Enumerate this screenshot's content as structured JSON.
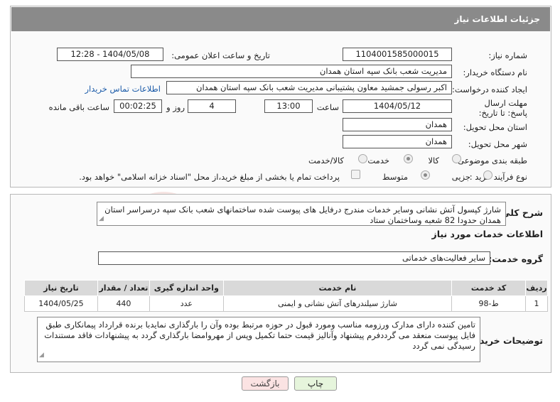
{
  "header": {
    "title": "جزئیات اطلاعات نیاز"
  },
  "fields": {
    "need_number_label": "شماره نیاز:",
    "need_number": "1104001585000015",
    "announce_label": "تاریخ و ساعت اعلان عمومی:",
    "announce_value": "1404/05/08 - 12:28",
    "buyer_label": "نام دستگاه خریدار:",
    "buyer_value": "مدیریت شعب بانک سپه استان همدان",
    "creator_label": "ایجاد کننده درخواست:",
    "creator_value": "اکبر رسولی جمشید معاون پشتیبانی مدیریت شعب بانک سپه استان همدان",
    "contact_link": "اطلاعات تماس خریدار",
    "deadline_label": "مهلت ارسال پاسخ: تا تاریخ:",
    "deadline_date": "1404/05/12",
    "time_label": "ساعت",
    "deadline_time": "13:00",
    "days_value": "4",
    "days_label": "روز و",
    "remaining_value": "00:02:25",
    "remaining_label": "ساعت باقی مانده",
    "province_label": "استان محل تحویل:",
    "province_value": "همدان",
    "city_label": "شهر محل تحویل:",
    "city_value": "همدان",
    "category_label": "طبقه بندی موضوعی:",
    "category_options": [
      "کالا",
      "خدمت",
      "کالا/خدمت"
    ],
    "process_label": "نوع فرآیند خرید :",
    "process_options": [
      "جزیی",
      "متوسط"
    ],
    "payment_note": "پرداخت تمام یا بخشی از مبلغ خرید،از محل \"اسناد خزانه اسلامی\" خواهد بود."
  },
  "description": {
    "label": "شرح کلی نیاز:",
    "text": "شارژ کپسول آتش نشانی وسایر خدمات مندرج درفایل های پیوست شده ساختمانهای شعب بانک سپه درسراسر استان همدان حدودا 82 شعبه وساختمان ستاد"
  },
  "services": {
    "section_title": "اطلاعات خدمات مورد نیاز",
    "group_label": "گروه خدمت:",
    "group_value": "سایر فعالیت‌های خدماتی",
    "columns": [
      "ردیف",
      "کد خدمت",
      "نام خدمت",
      "واحد اندازه گیری",
      "تعداد / مقدار",
      "تاریخ نیاز"
    ],
    "rows": [
      {
        "row": "1",
        "code": "ط-98",
        "name": "شارژ سیلندرهای آتش نشانی و ایمنی",
        "unit": "عدد",
        "qty": "440",
        "date": "1404/05/25"
      }
    ]
  },
  "buyer_notes": {
    "label": "توضیحات خریدار:",
    "text": "تامین کننده دارای مدارک ورزومه مناسب ومورد قبول در حوزه مرتبط بوده وآن را بارگذاری نمایدبا برنده قرارداد پیمانکاری طبق فایل پیوست منعقد می گرددفرم پیشنهاد وآنالیز قیمت حتما تکمیل وپس از مهروامضا بارگذاری گردد به پیشنهادات فاقد مستندات رسیدگی نمی گردد"
  },
  "buttons": {
    "print": "چاپ",
    "back": "بازگشت"
  },
  "colors": {
    "header_bg": "#8a8a8a",
    "print_bg": "#e6f5dc",
    "back_bg": "#fbe3e3",
    "link": "#1a5aa8"
  }
}
